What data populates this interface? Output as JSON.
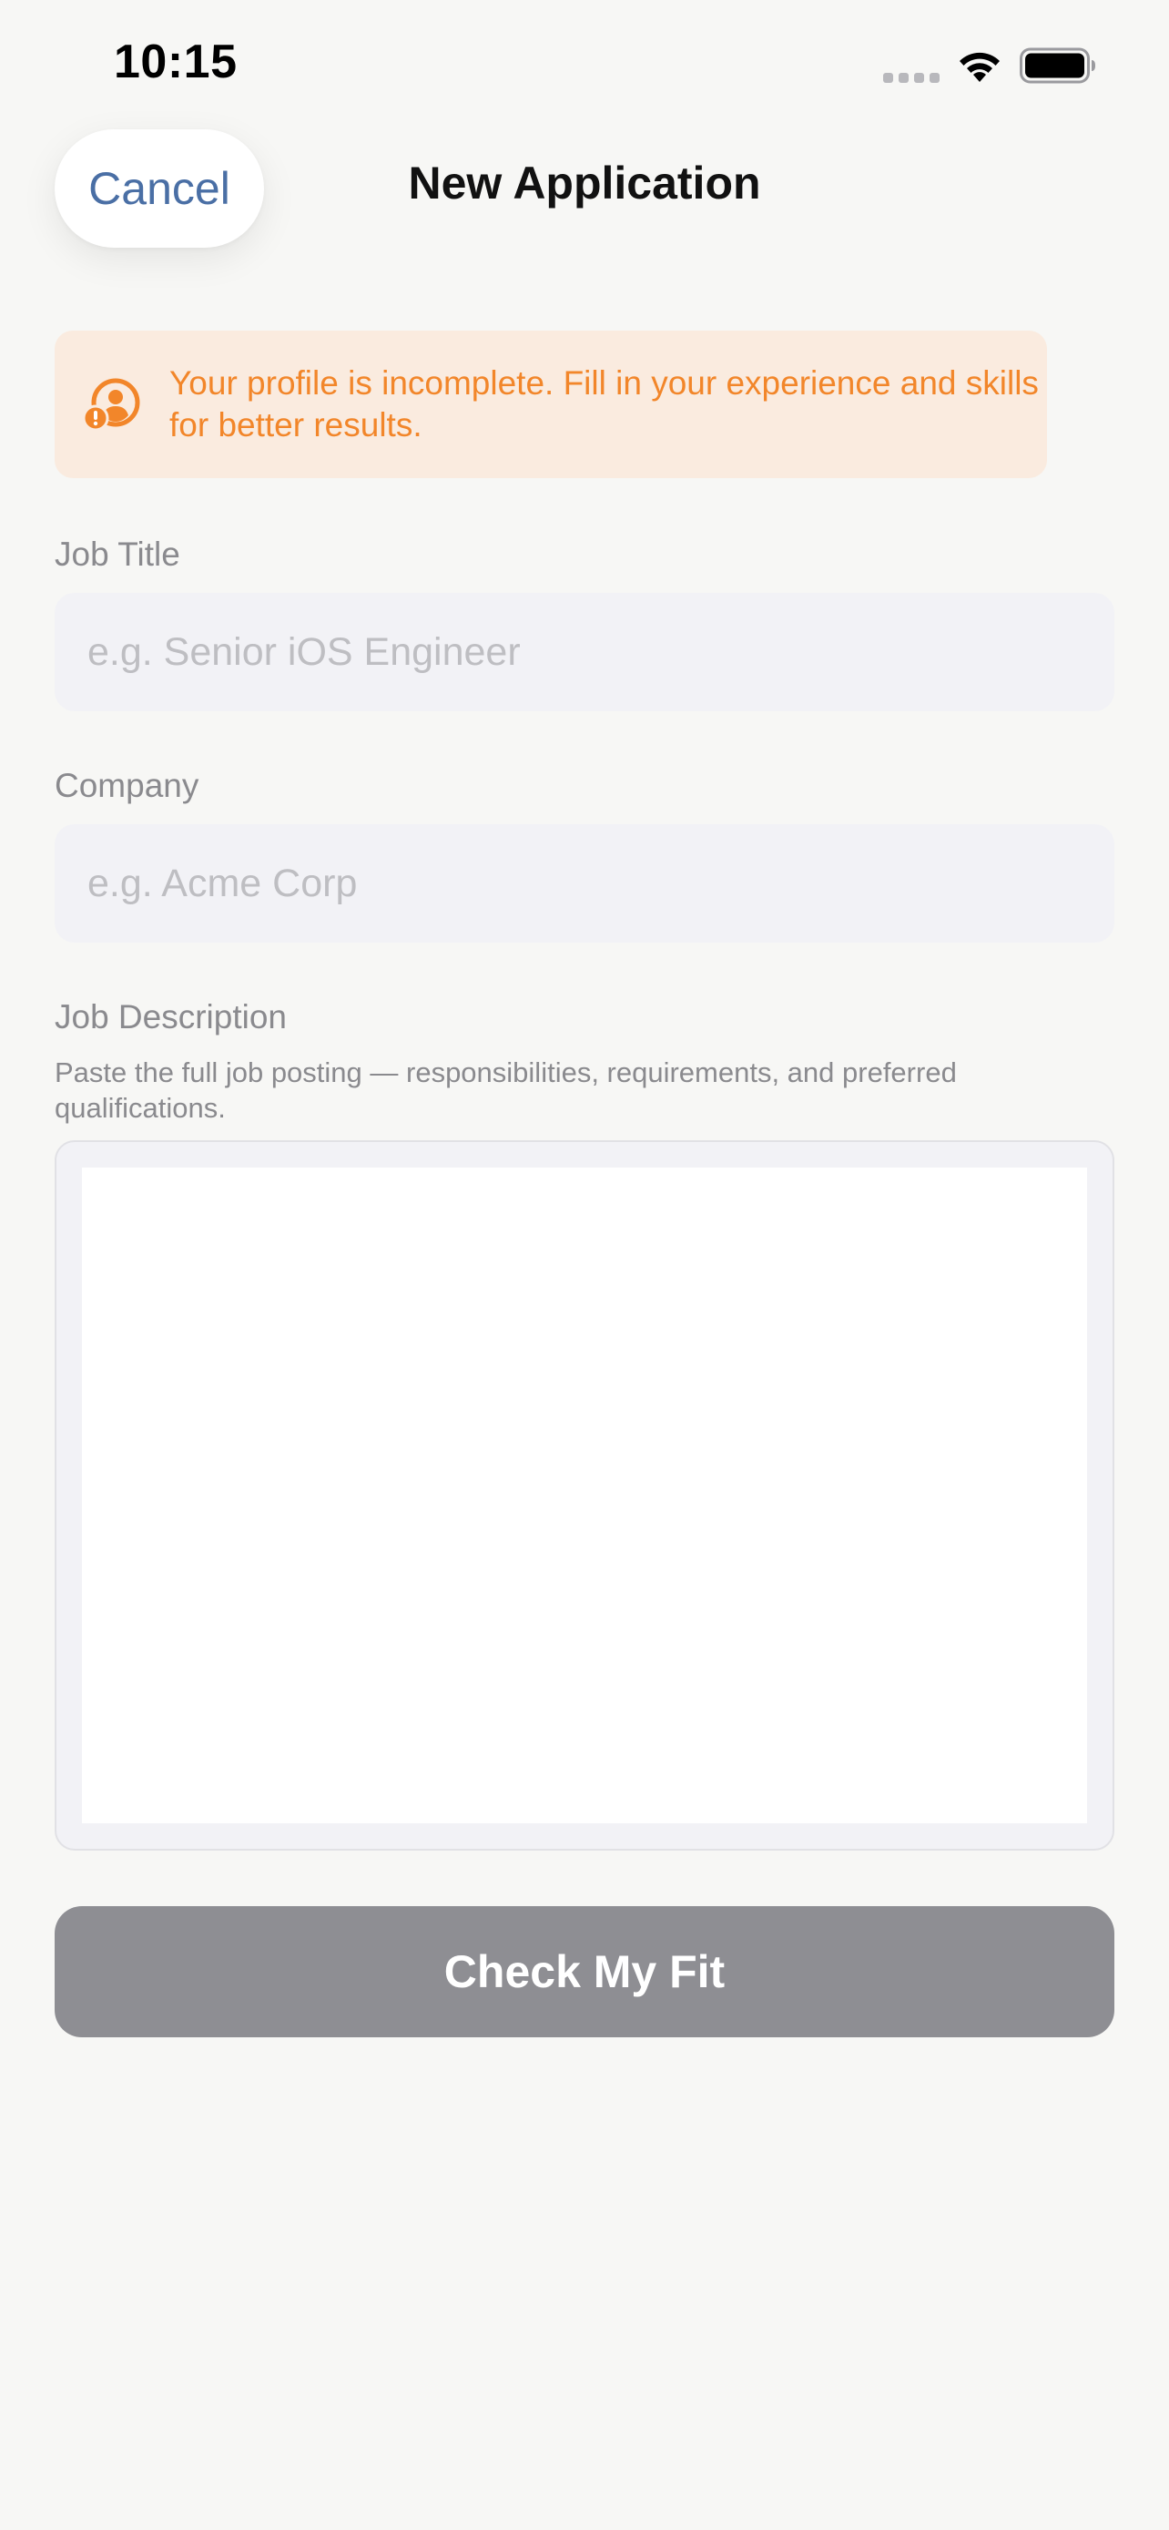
{
  "status_bar": {
    "time": "10:15",
    "icons": [
      "cellular-signal-icon",
      "wifi-icon",
      "battery-icon"
    ]
  },
  "nav": {
    "cancel_label": "Cancel",
    "title": "New Application"
  },
  "warning": {
    "icon": "profile-warning-icon",
    "message": "Your profile is incomplete. Fill in your experience and skills for better results."
  },
  "form": {
    "job_title": {
      "label": "Job Title",
      "placeholder": "e.g. Senior iOS Engineer",
      "value": ""
    },
    "company": {
      "label": "Company",
      "placeholder": "e.g. Acme Corp",
      "value": ""
    },
    "job_description": {
      "label": "Job Description",
      "hint": "Paste the full job posting — responsibilities, requirements, and preferred qualifications.",
      "value": ""
    }
  },
  "submit": {
    "label": "Check My Fit",
    "enabled": false
  },
  "colors": {
    "accent_blue": "#4A6FA5",
    "warning_orange": "#F2862A",
    "warning_background": "#FAEBDF",
    "disabled_button": "#8E8E93",
    "input_background": "#F2F2F6",
    "screen_background": "#F7F7F5"
  }
}
